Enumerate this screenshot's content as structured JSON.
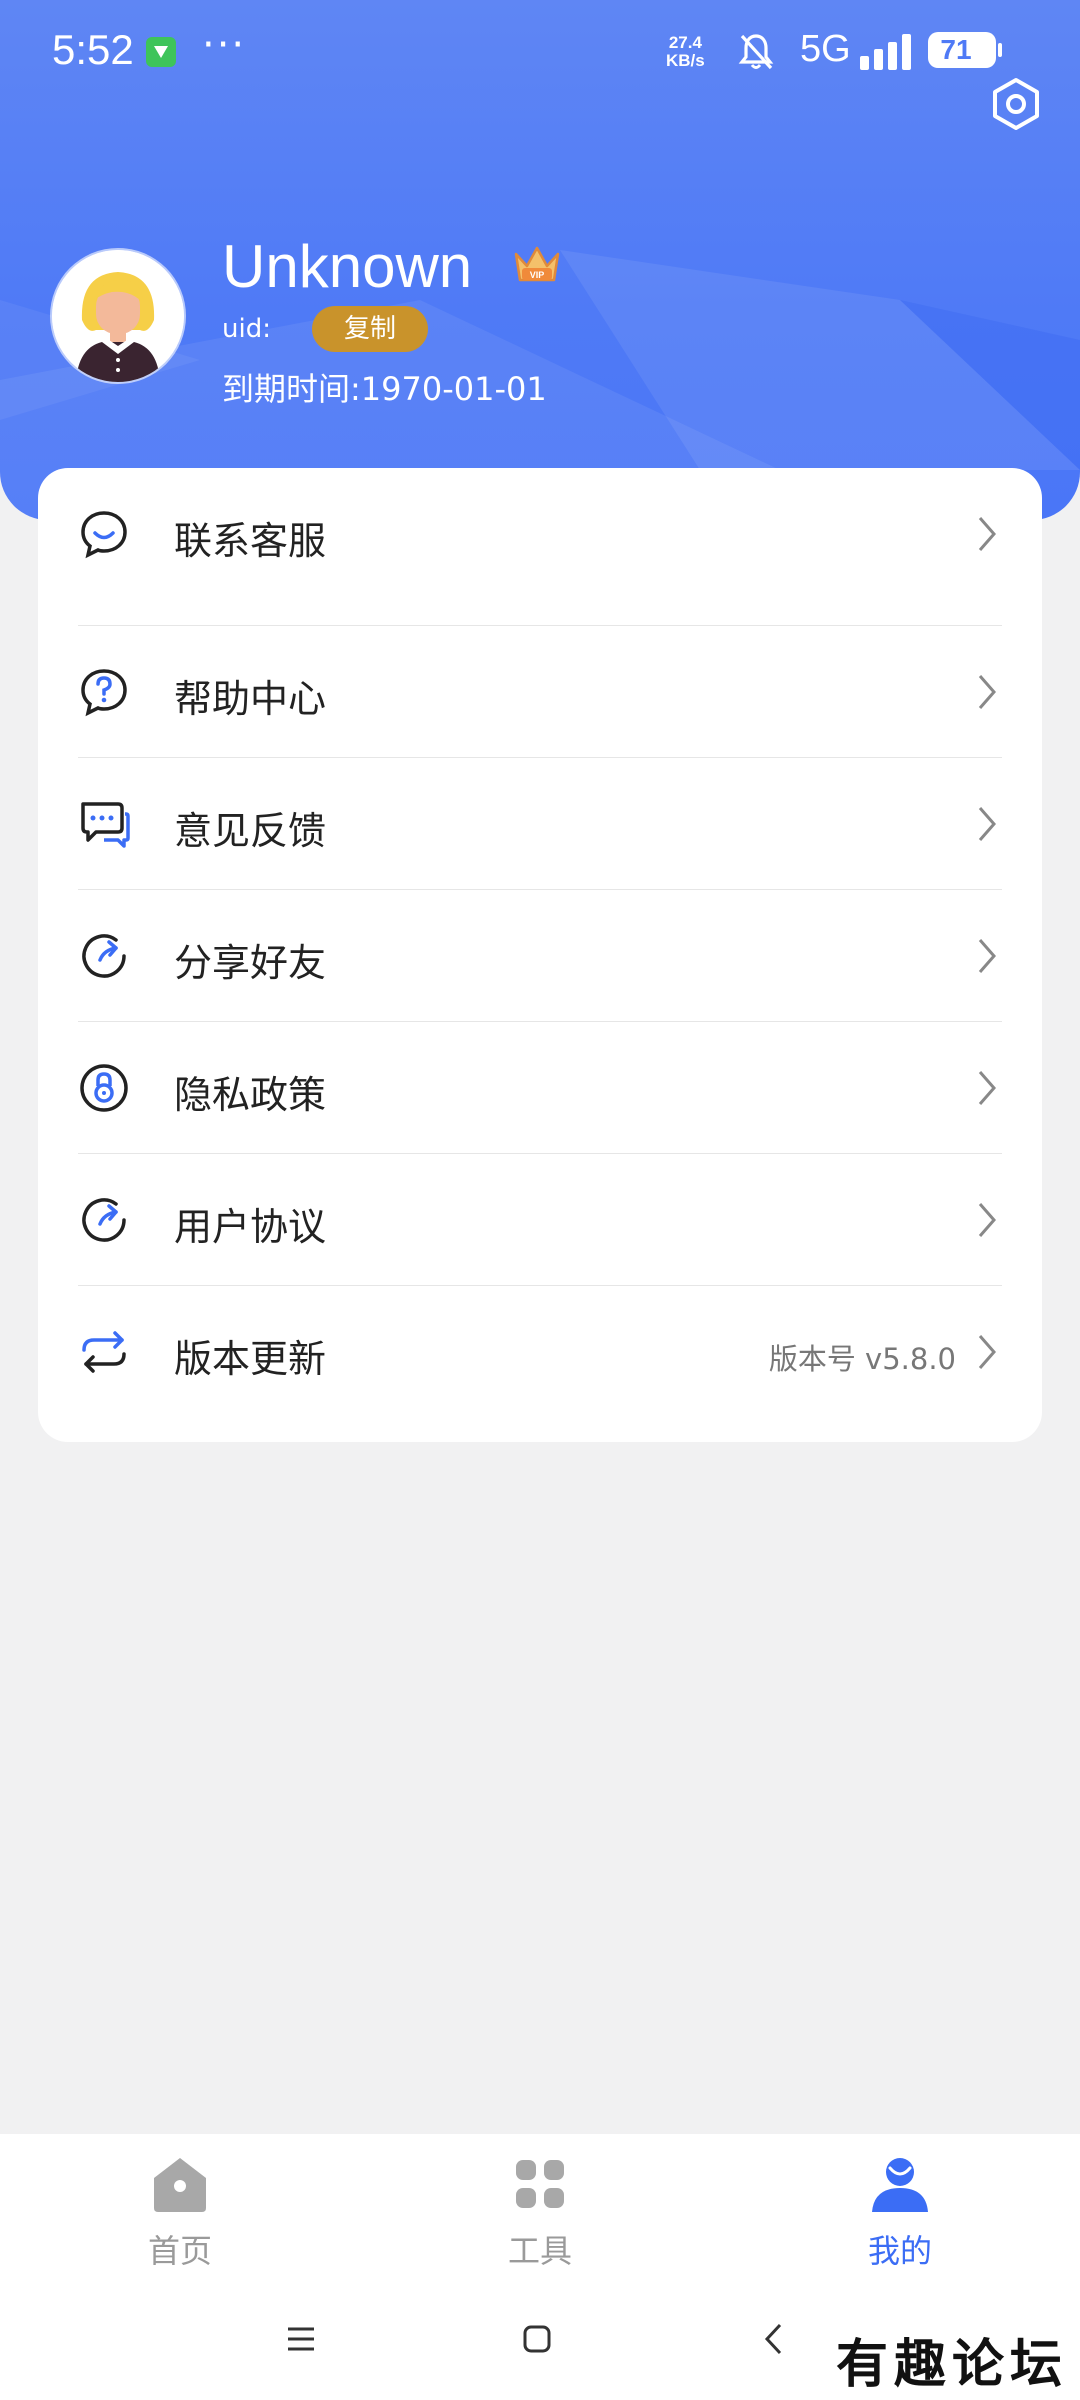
{
  "status_bar": {
    "time": "5:52",
    "more": "···",
    "netspeed_value": "27.4",
    "netspeed_unit": "KB/s",
    "network": "5G",
    "battery": "71"
  },
  "profile": {
    "username": "Unknown",
    "vip_badge": "VIP",
    "uid_label": "uid:",
    "copy_label": "复制",
    "expiry": "到期时间:1970-01-01"
  },
  "menu": {
    "items": [
      {
        "label": "联系客服",
        "icon": "chat-bubble-icon"
      },
      {
        "label": "帮助中心",
        "icon": "help-question-icon"
      },
      {
        "label": "意见反馈",
        "icon": "feedback-icon"
      },
      {
        "label": "分享好友",
        "icon": "share-icon"
      },
      {
        "label": "隐私政策",
        "icon": "privacy-lock-icon"
      },
      {
        "label": "用户协议",
        "icon": "agreement-icon"
      },
      {
        "label": "版本更新",
        "icon": "update-refresh-icon",
        "extra": "版本号 v5.8.0"
      }
    ]
  },
  "tabs": [
    {
      "label": "首页",
      "icon": "home-icon"
    },
    {
      "label": "工具",
      "icon": "grid-apps-icon"
    },
    {
      "label": "我的",
      "icon": "user-icon"
    }
  ],
  "watermark": "有趣论坛",
  "colors": {
    "header_blue": "#4f7af6",
    "accent_blue": "#3b6df5",
    "copy_gold": "#c9932b",
    "background": "#f1f1f2"
  }
}
